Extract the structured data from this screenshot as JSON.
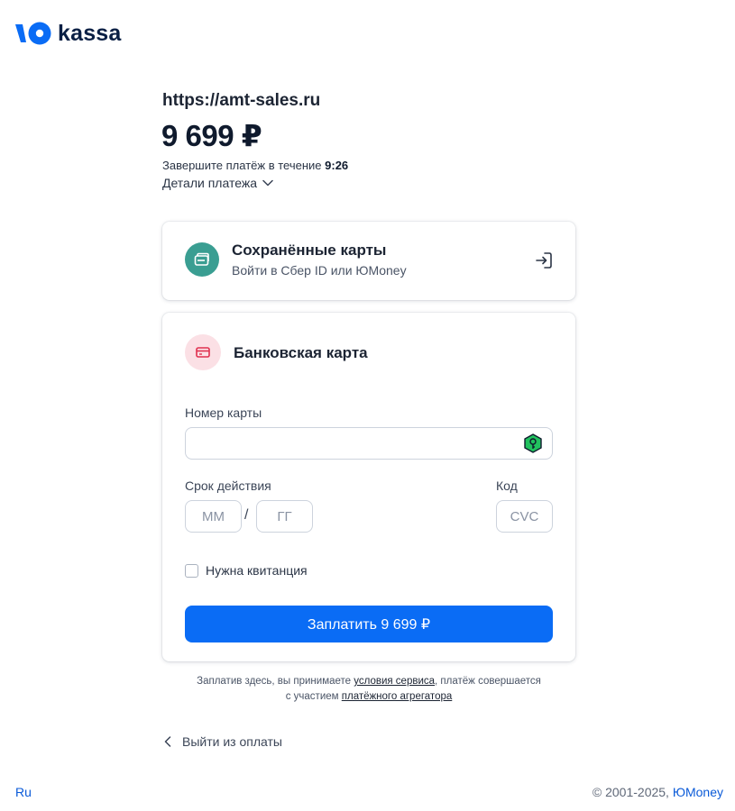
{
  "brand": {
    "logo_text": "kassa",
    "accent_color": "#0a6cf5"
  },
  "payment": {
    "merchant": "https://amt-sales.ru",
    "amount": "9 699 ₽",
    "timer_prefix": "Завершите платёж в течение",
    "timer_value": "9:26",
    "details_label": "Детали платежа"
  },
  "saved_cards": {
    "title": "Сохранённые карты",
    "subtitle": "Войти в Сбер ID или ЮMoney",
    "icon": "wallet-icon",
    "action_icon": "login-icon",
    "icon_bg": "#3a9e92"
  },
  "bank_card": {
    "title": "Банковская карта",
    "icon": "credit-card-icon",
    "icon_bg": "#fbe0e5",
    "card_number": {
      "label": "Номер карты",
      "value": "",
      "placeholder": ""
    },
    "expiry": {
      "label": "Срок действия",
      "month_placeholder": "ММ",
      "separator": "/",
      "year_placeholder": "ГГ"
    },
    "cvc": {
      "label": "Код",
      "placeholder": "CVC"
    },
    "receipt": {
      "label": "Нужна квитанция",
      "checked": false
    },
    "pay_button": "Заплатить  9 699 ₽"
  },
  "legal": {
    "text_1": "Заплатив здесь, вы принимаете ",
    "link_1": "условия сервиса",
    "text_2": ", платёж совершается",
    "text_3": "с участием ",
    "link_2": "платёжного агрегатора"
  },
  "exit_label": "Выйти из оплаты",
  "footer": {
    "language": "Ru",
    "copyright": "© 2001-2025, ",
    "company_link": "ЮMoney"
  }
}
